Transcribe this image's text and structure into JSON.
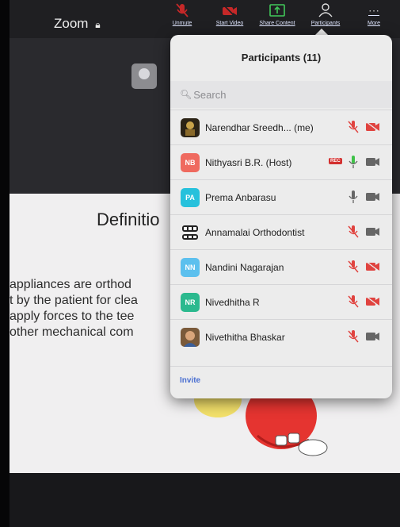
{
  "app": {
    "title": "Zoom"
  },
  "toolbar": {
    "unmute_label": "Unmute",
    "start_video_label": "Start Video",
    "share_content_label": "Share Content",
    "participants_label": "Participants",
    "more_label": "More"
  },
  "slide": {
    "title": "Definitio",
    "lines": [
      "appliances are orthod",
      "t by the patient for clea",
      "apply forces to the tee",
      "other mechanical com"
    ]
  },
  "panel": {
    "title": "Participants (11)",
    "search_placeholder": "Search",
    "invite_label": "Invite",
    "participants": [
      {
        "initials": "",
        "name": "Narendhar Sreedh...  (me)",
        "avatar_color": "#2c2416",
        "mic": "muted",
        "camera": "off"
      },
      {
        "initials": "NB",
        "name": "Nithyasri B.R. (Host)",
        "avatar_color": "#ef6a5f",
        "badge": "REC",
        "mic": "on",
        "camera": "on"
      },
      {
        "initials": "PA",
        "name": "Prema Anbarasu",
        "avatar_color": "#27c1dc",
        "mic": "on-idle",
        "camera": "on"
      },
      {
        "initials": "",
        "name": "Annamalai Orthodontist",
        "avatar_color": "#ececec",
        "mic": "muted",
        "camera": "on"
      },
      {
        "initials": "NN",
        "name": "Nandini Nagarajan",
        "avatar_color": "#5cc0ee",
        "mic": "muted",
        "camera": "off"
      },
      {
        "initials": "NR",
        "name": "Nivedhitha R",
        "avatar_color": "#2bb98e",
        "mic": "muted",
        "camera": "off"
      },
      {
        "initials": "",
        "name": "Nivethitha Bhaskar",
        "avatar_color": "#7a5a3a",
        "mic": "muted",
        "camera": "on"
      }
    ]
  },
  "colors": {
    "muted_red": "#e0433f",
    "active_green": "#3fc249",
    "icon_gray": "#666",
    "link_blue": "#4a6fd1"
  }
}
